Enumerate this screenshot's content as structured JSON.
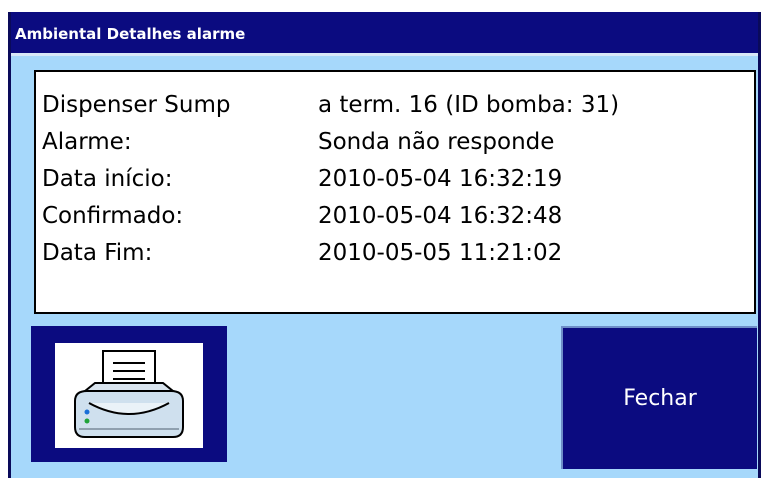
{
  "window": {
    "title": "Ambiental Detalhes alarme"
  },
  "details": [
    {
      "label": "Dispenser Sump",
      "value": "a term. 16 (ID bomba: 31)"
    },
    {
      "label": "Alarme:",
      "value": "Sonda não responde"
    },
    {
      "label": "Data início:",
      "value": "2010-05-04 16:32:19"
    },
    {
      "label": "Confirmado:",
      "value": "2010-05-04 16:32:48"
    },
    {
      "label": "Data Fim:",
      "value": "2010-05-05 11:21:02"
    }
  ],
  "buttons": {
    "print_icon": "printer-icon",
    "close_label": "Fechar"
  },
  "colors": {
    "title_bar": "#0b0b80",
    "background": "#a6d8fb",
    "button": "#0b0b80"
  }
}
